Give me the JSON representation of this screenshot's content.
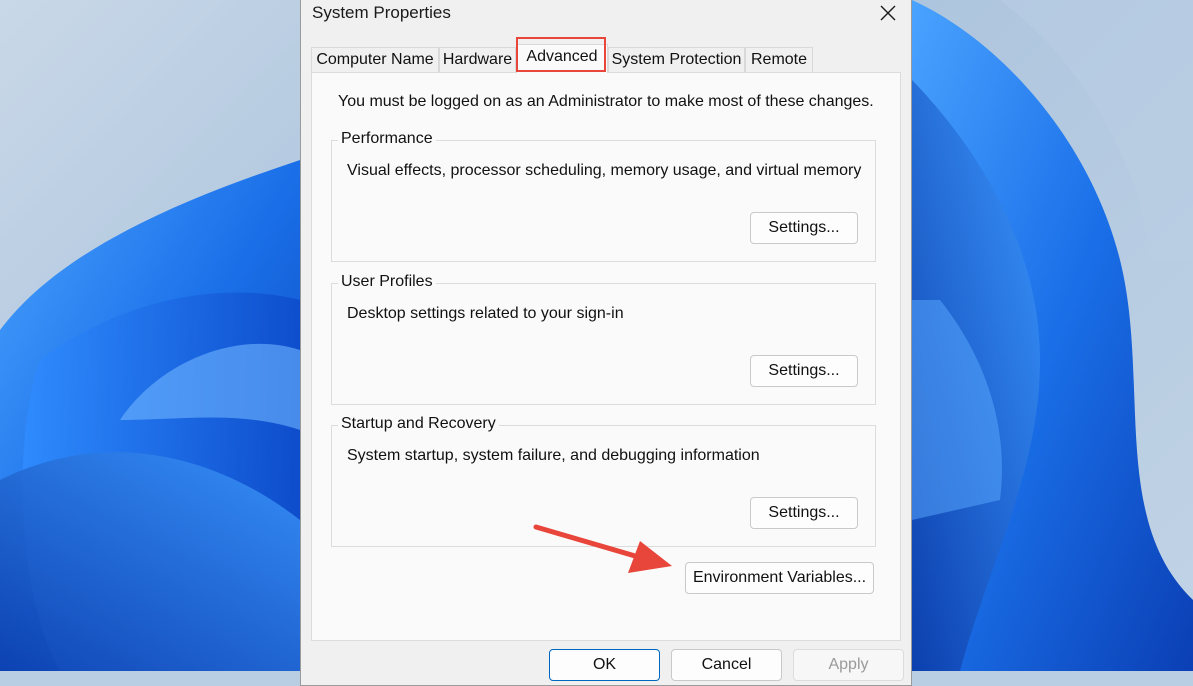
{
  "dialog": {
    "title": "System Properties",
    "close_icon": "close-icon"
  },
  "tabs": [
    {
      "label": "Computer Name"
    },
    {
      "label": "Hardware"
    },
    {
      "label": "Advanced",
      "active": true
    },
    {
      "label": "System Protection"
    },
    {
      "label": "Remote"
    }
  ],
  "panel": {
    "admin_note": "You must be logged on as an Administrator to make most of these changes.",
    "groups": [
      {
        "title": "Performance",
        "description": "Visual effects, processor scheduling, memory usage, and virtual memory",
        "button": "Settings..."
      },
      {
        "title": "User Profiles",
        "description": "Desktop settings related to your sign-in",
        "button": "Settings..."
      },
      {
        "title": "Startup and Recovery",
        "description": "System startup, system failure, and debugging information",
        "button": "Settings..."
      }
    ],
    "env_button": "Environment Variables..."
  },
  "footer": {
    "ok": "OK",
    "cancel": "Cancel",
    "apply": "Apply"
  },
  "colors": {
    "highlight": "#e8463b",
    "wallpaper_blue": "#1565e6"
  }
}
